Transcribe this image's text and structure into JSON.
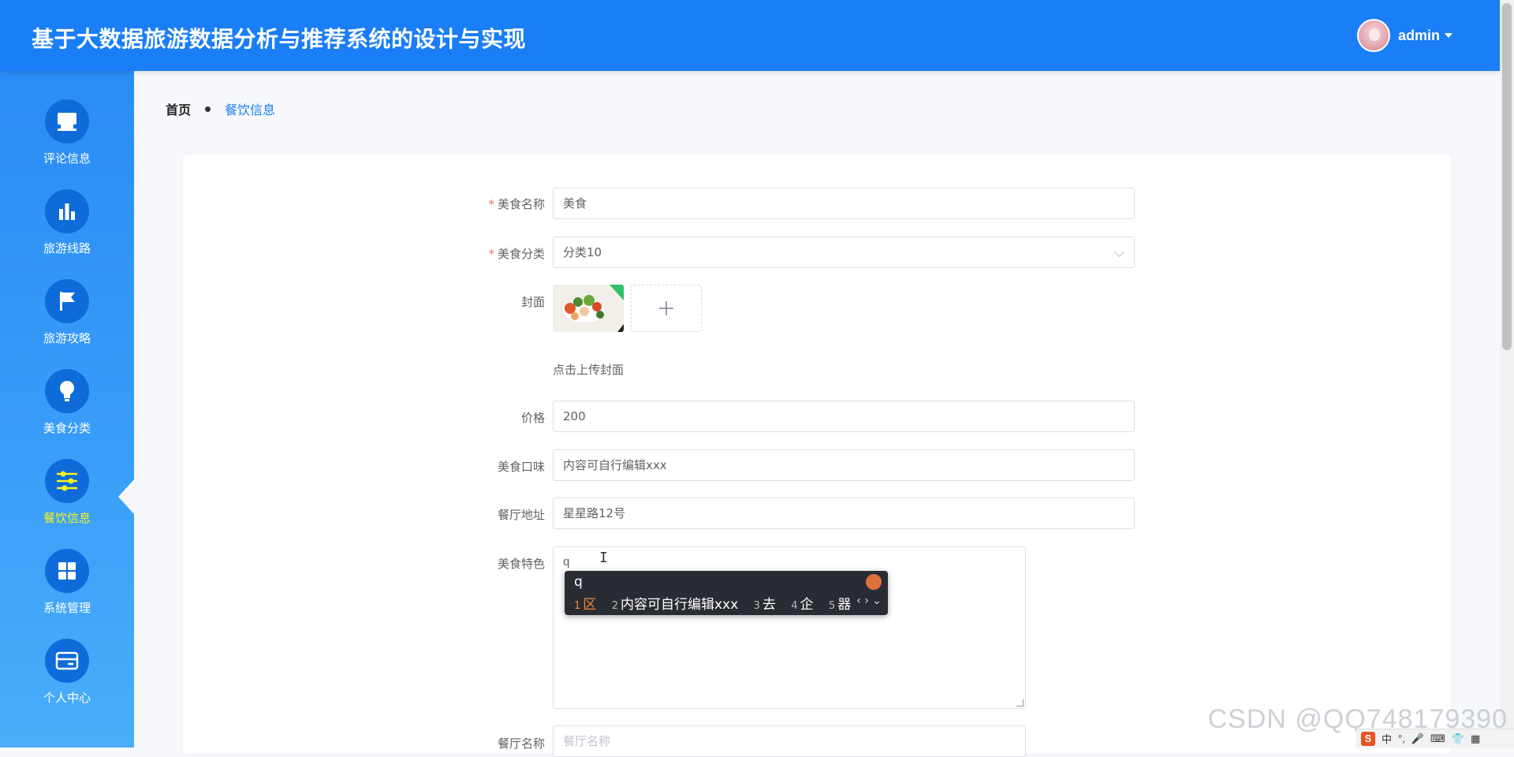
{
  "header": {
    "title": "基于大数据旅游数据分析与推荐系统的设计与实现",
    "username": "admin"
  },
  "sidebar": {
    "items": [
      {
        "label": "评论信息",
        "icon": "monitor-icon"
      },
      {
        "label": "旅游线路",
        "icon": "bar-chart-icon"
      },
      {
        "label": "旅游攻略",
        "icon": "flag-icon"
      },
      {
        "label": "美食分类",
        "icon": "lightbulb-icon"
      },
      {
        "label": "餐饮信息",
        "icon": "sliders-icon",
        "active": true
      },
      {
        "label": "系统管理",
        "icon": "grid-icon"
      },
      {
        "label": "个人中心",
        "icon": "card-icon"
      }
    ]
  },
  "breadcrumb": {
    "home": "首页",
    "current": "餐饮信息"
  },
  "form": {
    "name_label": "美食名称",
    "name_value": "美食",
    "category_label": "美食分类",
    "category_value": "分类10",
    "cover_label": "封面",
    "upload_hint": "点击上传封面",
    "price_label": "价格",
    "price_value": "200",
    "taste_label": "美食口味",
    "taste_value": "内容可自行编辑xxx",
    "address_label": "餐厅地址",
    "address_value": "星星路12号",
    "feature_label": "美食特色",
    "feature_value": "q",
    "restaurant_label": "餐厅名称",
    "restaurant_placeholder": "餐厅名称"
  },
  "ime": {
    "input": "q",
    "candidates": [
      {
        "num": "1",
        "text": "区",
        "selected": true
      },
      {
        "num": "2",
        "text": "内容可自行编辑xxx"
      },
      {
        "num": "3",
        "text": "去"
      },
      {
        "num": "4",
        "text": "企"
      },
      {
        "num": "5",
        "text": "器"
      }
    ]
  },
  "watermark": "CSDN @QQ748179390",
  "tray": {
    "lang": "中",
    "punct": "°,"
  },
  "colors": {
    "primary": "#1a7ef6",
    "sidebar_active_text": "#f8f21c",
    "required": "#f56c6c"
  }
}
